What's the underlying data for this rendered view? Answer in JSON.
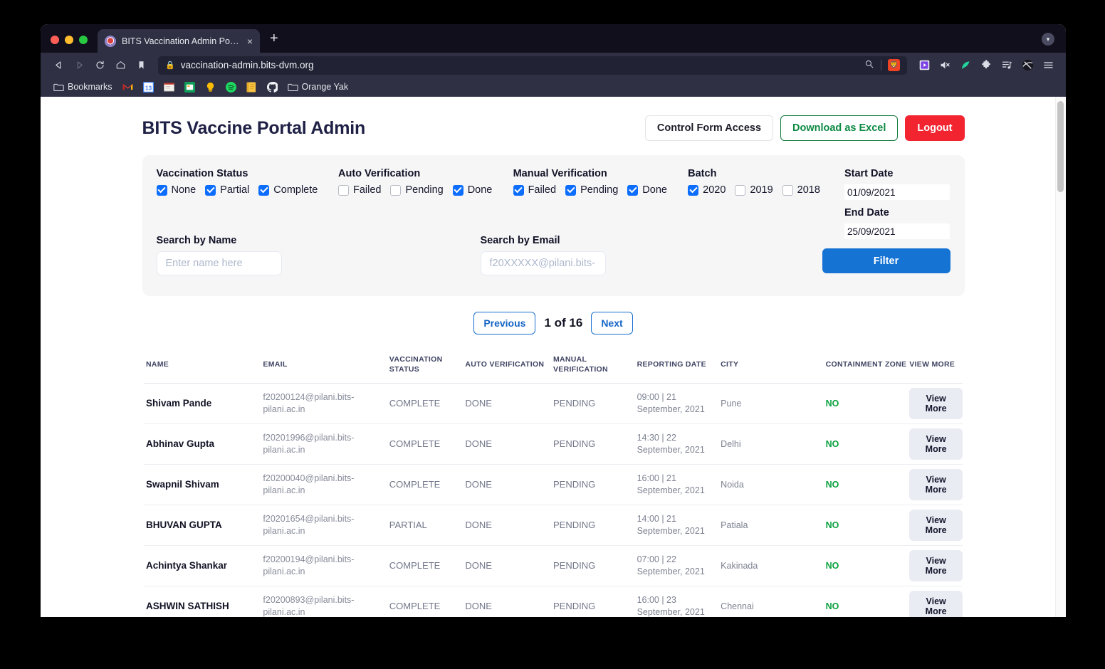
{
  "browser": {
    "tab": {
      "title": "BITS Vaccination Admin Portal",
      "favicon": "bits-logo-icon",
      "close": "×"
    },
    "newtab_label": "+",
    "url": "vaccination-admin.bits-dvm.org",
    "lock_icon": "🔒",
    "nav": {
      "back": "back-arrow-icon",
      "forward": "forward-arrow-icon",
      "reload": "reload-icon",
      "home": "home-icon",
      "bookmark": "bookmark-icon"
    },
    "url_actions": {
      "search": "search-icon",
      "shield": "brave-shield-icon"
    },
    "extensions": [
      "extension-purple-icon",
      "mute-tab-icon",
      "extension-green-icon",
      "puzzle-icon",
      "playlist-icon",
      "globe-dark-icon",
      "menu-icon"
    ],
    "bookmarks_label": "Bookmarks",
    "bookmark_items": [
      {
        "label": "",
        "icon": "gmail-icon"
      },
      {
        "label": "",
        "icon": "google-calendar-icon"
      },
      {
        "label": "",
        "icon": "notes-icon"
      },
      {
        "label": "",
        "icon": "google-sheets-icon"
      },
      {
        "label": "",
        "icon": "google-keep-icon"
      },
      {
        "label": "",
        "icon": "spotify-icon"
      },
      {
        "label": "",
        "icon": "notebook-icon"
      },
      {
        "label": "",
        "icon": "github-icon"
      },
      {
        "label": "Orange Yak",
        "icon": "folder-icon"
      }
    ]
  },
  "app": {
    "title": "BITS Vaccine Portal Admin",
    "buttons": {
      "control_form_access": "Control Form Access",
      "download_excel": "Download as Excel",
      "logout": "Logout"
    },
    "colors": {
      "title": "#1f2045",
      "logout_bg": "#f22430",
      "excel_border": "#0f7a3d",
      "filter_bg": "#1573d4",
      "checkbox_on": "#0d6efd",
      "zone_no": "#0aa13f"
    }
  },
  "filters": {
    "groups": [
      {
        "label": "Vaccination Status",
        "options": [
          {
            "label": "None",
            "checked": true
          },
          {
            "label": "Partial",
            "checked": true
          },
          {
            "label": "Complete",
            "checked": true
          }
        ]
      },
      {
        "label": "Auto Verification",
        "options": [
          {
            "label": "Failed",
            "checked": false
          },
          {
            "label": "Pending",
            "checked": false
          },
          {
            "label": "Done",
            "checked": true
          }
        ]
      },
      {
        "label": "Manual Verification",
        "options": [
          {
            "label": "Failed",
            "checked": true
          },
          {
            "label": "Pending",
            "checked": true
          },
          {
            "label": "Done",
            "checked": true
          }
        ]
      },
      {
        "label": "Batch",
        "options": [
          {
            "label": "2020",
            "checked": true
          },
          {
            "label": "2019",
            "checked": false
          },
          {
            "label": "2018",
            "checked": false
          }
        ]
      }
    ],
    "start_date": {
      "label": "Start Date",
      "value": "01/09/2021"
    },
    "end_date": {
      "label": "End Date",
      "value": "25/09/2021"
    },
    "search_name": {
      "label": "Search by Name",
      "value": "",
      "placeholder": "Enter name here"
    },
    "search_email": {
      "label": "Search by Email",
      "value": "",
      "placeholder": "f20XXXXX@pilani.bits-"
    },
    "filter_button": "Filter"
  },
  "pagination": {
    "previous": "Previous",
    "next": "Next",
    "info": "1 of 16"
  },
  "table": {
    "headers": [
      "NAME",
      "EMAIL",
      "VACCINATION STATUS",
      "AUTO VERIFICATION",
      "MANUAL VERIFICATION",
      "REPORTING DATE",
      "CITY",
      "CONTAINMENT ZONE",
      "VIEW MORE"
    ],
    "view_more_label": "View More",
    "rows": [
      {
        "name": "Shivam Pande",
        "email": "f20200124@pilani.bits-pilani.ac.in",
        "vaccination_status": "COMPLETE",
        "auto_verification": "DONE",
        "manual_verification": "PENDING",
        "reporting_date": "09:00 | 21 September, 2021",
        "city": "Pune",
        "containment_zone": "NO"
      },
      {
        "name": "Abhinav Gupta",
        "email": "f20201996@pilani.bits-pilani.ac.in",
        "vaccination_status": "COMPLETE",
        "auto_verification": "DONE",
        "manual_verification": "PENDING",
        "reporting_date": "14:30 | 22 September, 2021",
        "city": "Delhi",
        "containment_zone": "NO"
      },
      {
        "name": "Swapnil Shivam",
        "email": "f20200040@pilani.bits-pilani.ac.in",
        "vaccination_status": "COMPLETE",
        "auto_verification": "DONE",
        "manual_verification": "PENDING",
        "reporting_date": "16:00 | 21 September, 2021",
        "city": "Noida",
        "containment_zone": "NO"
      },
      {
        "name": "BHUVAN GUPTA",
        "email": "f20201654@pilani.bits-pilani.ac.in",
        "vaccination_status": "PARTIAL",
        "auto_verification": "DONE",
        "manual_verification": "PENDING",
        "reporting_date": "14:00 | 21 September, 2021",
        "city": "Patiala",
        "containment_zone": "NO"
      },
      {
        "name": "Achintya Shankar",
        "email": "f20200194@pilani.bits-pilani.ac.in",
        "vaccination_status": "COMPLETE",
        "auto_verification": "DONE",
        "manual_verification": "PENDING",
        "reporting_date": "07:00 | 22 September, 2021",
        "city": "Kakinada",
        "containment_zone": "NO"
      },
      {
        "name": "ASHWIN SATHISH",
        "email": "f20200893@pilani.bits-pilani.ac.in",
        "vaccination_status": "COMPLETE",
        "auto_verification": "DONE",
        "manual_verification": "PENDING",
        "reporting_date": "16:00 | 23 September, 2021",
        "city": "Chennai",
        "containment_zone": "NO"
      }
    ]
  }
}
